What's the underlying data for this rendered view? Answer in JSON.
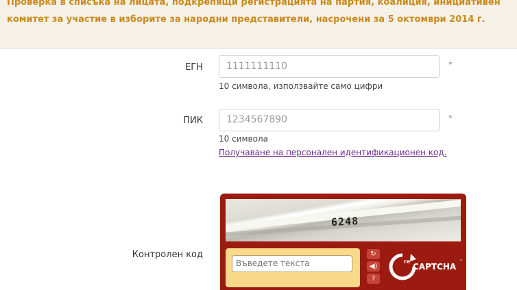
{
  "header": {
    "text": "Проверка в списъка на лицата, подкрепящи регистрацията на партия, коалиция, инициативен комитет за участие в изборите за народни представители, насрочени за 5 октомври 2014 г."
  },
  "form": {
    "egn": {
      "label": "ЕГН",
      "value": "1111111110",
      "required_mark": "*",
      "hint": "10 символа, използвайте само цифри"
    },
    "pik": {
      "label": "ПИК",
      "value": "1234567890",
      "required_mark": "*",
      "hint": "10 символа",
      "link": "Получаване на персонален идентификационен код",
      "link_suffix": "."
    },
    "captcha": {
      "label": "Контролен код",
      "challenge_word": "6248",
      "input_placeholder": "Въведете текста",
      "brand_re": "re",
      "brand_captcha": "CAPTCHA",
      "brand_tm": "™",
      "buttons": [
        "↻",
        "◀)",
        "?"
      ]
    }
  },
  "colors": {
    "header_text": "#c98a1f",
    "header_bg": "#f6f1e6",
    "recaptcha_bg": "#9b1b10",
    "recaptcha_entry_bg": "#f9d98a",
    "link": "#6b2b8c"
  }
}
